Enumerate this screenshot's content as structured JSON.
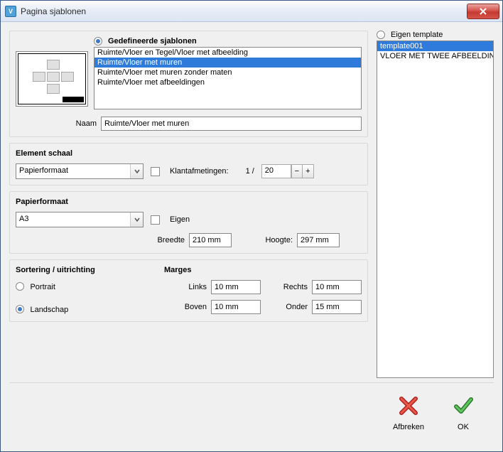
{
  "window": {
    "title": "Pagina sjablonen"
  },
  "defined": {
    "radio_label": "Gedefineerde sjablonen",
    "items": [
      "Ruimte/Vloer en Tegel/Vloer met afbeelding",
      "Ruimte/Vloer met muren",
      "Ruimte/Vloer met muren zonder maten",
      "Ruimte/Vloer met afbeeldingen"
    ],
    "selected_index": 1
  },
  "own": {
    "radio_label": "Eigen template",
    "items": [
      "template001",
      "VLOER MET TWEE AFBEELDING"
    ],
    "selected_index": 0
  },
  "name": {
    "label": "Naam",
    "value": "Ruimte/Vloer met muren"
  },
  "element_scale": {
    "title": "Element schaal",
    "combo_value": "Papierformaat",
    "custom_dims_label": "Klantafmetingen:",
    "ratio_prefix": "1 /",
    "ratio_value": "20"
  },
  "paper": {
    "title": "Papierformaat",
    "combo_value": "A3",
    "custom_label": "Eigen",
    "width_label": "Breedte",
    "width_value": "210 mm",
    "height_label": "Hoogte:",
    "height_value": "297 mm"
  },
  "sort": {
    "title": "Sortering / uitrichting",
    "portrait": "Portrait",
    "landscape": "Landschap",
    "selected": "landscape"
  },
  "margins": {
    "title": "Marges",
    "left_label": "Links",
    "left_value": "10 mm",
    "right_label": "Rechts",
    "right_value": "10 mm",
    "top_label": "Boven",
    "top_value": "10 mm",
    "bottom_label": "Onder",
    "bottom_value": "15 mm"
  },
  "buttons": {
    "cancel": "Afbreken",
    "ok": "OK"
  }
}
